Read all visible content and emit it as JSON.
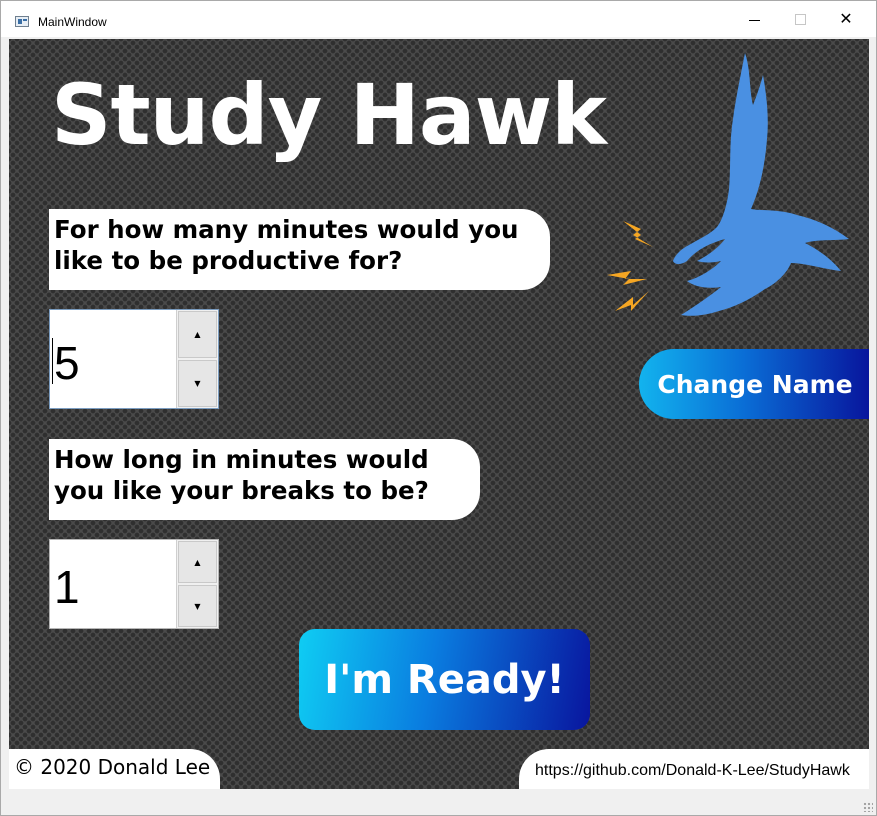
{
  "window": {
    "title": "MainWindow",
    "app_icon": "window-app-icon",
    "minimize_icon": "minimize-icon",
    "maximize_icon": "maximize-icon",
    "close_glyph": "✕"
  },
  "header": {
    "app_title": "Study Hawk",
    "logo_icon": "hawk-icon"
  },
  "questions": {
    "work": {
      "text": "For how many minutes would you like to be productive for?",
      "value": "5"
    },
    "break": {
      "text": "How long in minutes would you like your breaks to be?",
      "value": "1"
    }
  },
  "spin_arrows": {
    "up": "▲",
    "down": "▼"
  },
  "buttons": {
    "change_name": "Change Name",
    "ready": "I'm Ready!"
  },
  "footer": {
    "copyright": "© 2020 Donald Lee",
    "link": "https://github.com/Donald-K-Lee/StudyHawk"
  },
  "colors": {
    "button_start": "#12b3ee",
    "button_end": "#08149c",
    "hawk": "#4a90e2",
    "lightning": "#f5a623",
    "background": "#4a4a4a"
  }
}
